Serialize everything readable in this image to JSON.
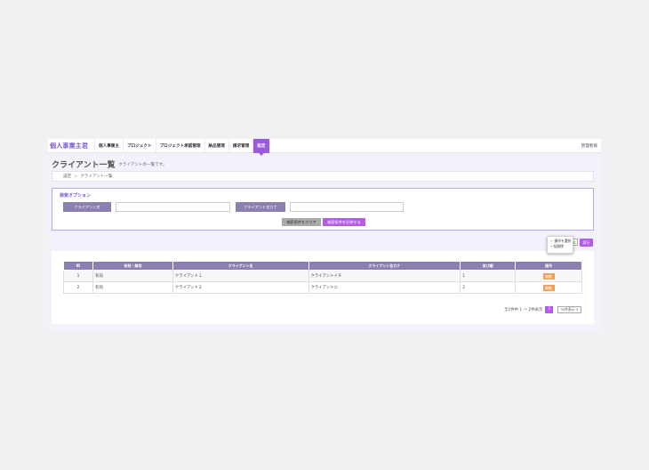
{
  "app": {
    "brand": "個人事業主君",
    "user": "管理者様"
  },
  "nav": {
    "items": [
      {
        "label": "個人事業主"
      },
      {
        "label": "プロジェクト"
      },
      {
        "label": "プロジェクト承認管理"
      },
      {
        "label": "納品管理"
      },
      {
        "label": "請求管理"
      },
      {
        "label": "設定"
      }
    ],
    "active_index": 5
  },
  "page": {
    "title": "クライアント一覧",
    "subtitle": "クライアントの一覧です。"
  },
  "breadcrumb": {
    "items": [
      "設定",
      "クライアント一覧"
    ],
    "separator": ">"
  },
  "search": {
    "heading": "検索オプション",
    "fields": [
      {
        "label": "クライアント名",
        "value": ""
      },
      {
        "label": "クライアント名カナ",
        "value": ""
      }
    ],
    "clear_label": "検索条件をクリア",
    "submit_label": "検索条件を反映する"
  },
  "bulk": {
    "options": [
      "✓ 操作を選択",
      "一括削除"
    ],
    "select_arrow": "⇕",
    "run_label": "実行"
  },
  "table": {
    "columns": [
      "ID",
      "有効・無効",
      "クライアント名",
      "クライアント名カナ",
      "並び順",
      "操作"
    ],
    "rows": [
      {
        "id": "1",
        "status": "有効",
        "name": "クライアント１",
        "kana": "クライアントイチ",
        "order": "1",
        "action": "編集"
      },
      {
        "id": "2",
        "status": "有効",
        "name": "クライアント２",
        "kana": "クライアントニ",
        "order": "2",
        "action": "編集"
      }
    ]
  },
  "pager": {
    "summary": "全2件中 1 〜 2件表示",
    "current_page": "1",
    "per_page": "30件表示 ⇕"
  },
  "colors": {
    "accent": "#9b5be0",
    "header_bg": "#8c7fb2",
    "edit_button": "#f0a05a"
  }
}
